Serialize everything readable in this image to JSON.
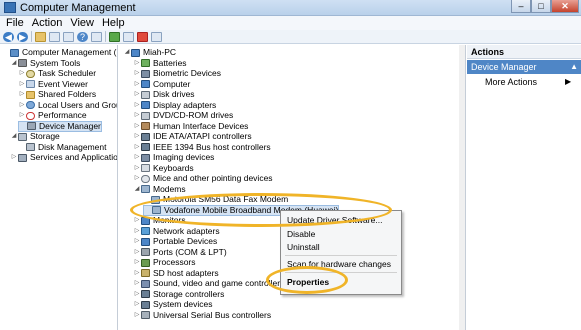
{
  "window": {
    "title": "Computer Management"
  },
  "menu": [
    "File",
    "Action",
    "View",
    "Help"
  ],
  "left_tree": [
    {
      "label": "Computer Management (Local",
      "icon": "computer-management-icon",
      "depth": 0,
      "exp": ""
    },
    {
      "label": "System Tools",
      "icon": "system-tools-icon",
      "depth": 1,
      "exp": "◢"
    },
    {
      "label": "Task Scheduler",
      "icon": "task-scheduler-icon",
      "depth": 2,
      "exp": "▷"
    },
    {
      "label": "Event Viewer",
      "icon": "event-viewer-icon",
      "depth": 2,
      "exp": "▷"
    },
    {
      "label": "Shared Folders",
      "icon": "shared-folders-icon",
      "depth": 2,
      "exp": "▷"
    },
    {
      "label": "Local Users and Groups",
      "icon": "local-users-icon",
      "depth": 2,
      "exp": "▷"
    },
    {
      "label": "Performance",
      "icon": "performance-icon",
      "depth": 2,
      "exp": "▷"
    },
    {
      "label": "Device Manager",
      "icon": "device-manager-icon",
      "depth": 2,
      "exp": "",
      "selected": true
    },
    {
      "label": "Storage",
      "icon": "storage-icon",
      "depth": 1,
      "exp": "◢"
    },
    {
      "label": "Disk Management",
      "icon": "disk-management-icon",
      "depth": 2,
      "exp": ""
    },
    {
      "label": "Services and Applications",
      "icon": "services-icon",
      "depth": 1,
      "exp": "▷"
    }
  ],
  "device_tree": [
    {
      "label": "Miah-PC",
      "icon": "pc-icon",
      "depth": 0,
      "exp": "◢"
    },
    {
      "label": "Batteries",
      "icon": "battery-icon",
      "depth": 1,
      "exp": "▷"
    },
    {
      "label": "Biometric Devices",
      "icon": "biometric-icon",
      "depth": 1,
      "exp": "▷"
    },
    {
      "label": "Computer",
      "icon": "computer-icon",
      "depth": 1,
      "exp": "▷"
    },
    {
      "label": "Disk drives",
      "icon": "disk-drive-icon",
      "depth": 1,
      "exp": "▷"
    },
    {
      "label": "Display adapters",
      "icon": "display-adapter-icon",
      "depth": 1,
      "exp": "▷"
    },
    {
      "label": "DVD/CD-ROM drives",
      "icon": "dvd-drive-icon",
      "depth": 1,
      "exp": "▷"
    },
    {
      "label": "Human Interface Devices",
      "icon": "hid-icon",
      "depth": 1,
      "exp": "▷"
    },
    {
      "label": "IDE ATA/ATAPI controllers",
      "icon": "ide-controller-icon",
      "depth": 1,
      "exp": "▷"
    },
    {
      "label": "IEEE 1394 Bus host controllers",
      "icon": "ieee1394-icon",
      "depth": 1,
      "exp": "▷"
    },
    {
      "label": "Imaging devices",
      "icon": "imaging-icon",
      "depth": 1,
      "exp": "▷"
    },
    {
      "label": "Keyboards",
      "icon": "keyboard-icon",
      "depth": 1,
      "exp": "▷"
    },
    {
      "label": "Mice and other pointing devices",
      "icon": "mouse-icon",
      "depth": 1,
      "exp": "▷"
    },
    {
      "label": "Modems",
      "icon": "modem-icon",
      "depth": 1,
      "exp": "◢"
    },
    {
      "label": "Motorola SM56 Data Fax Modem",
      "icon": "modem-device-icon",
      "depth": 2,
      "exp": ""
    },
    {
      "label": "Vodafone Mobile Broadband Modem (Huawei)",
      "icon": "modem-device-icon",
      "depth": 2,
      "exp": "",
      "selected": true
    },
    {
      "label": "Monitors",
      "icon": "monitor-icon",
      "depth": 1,
      "exp": "▷"
    },
    {
      "label": "Network adapters",
      "icon": "network-adapter-icon",
      "depth": 1,
      "exp": "▷"
    },
    {
      "label": "Portable Devices",
      "icon": "portable-device-icon",
      "depth": 1,
      "exp": "▷"
    },
    {
      "label": "Ports (COM & LPT)",
      "icon": "ports-icon",
      "depth": 1,
      "exp": "▷"
    },
    {
      "label": "Processors",
      "icon": "processor-icon",
      "depth": 1,
      "exp": "▷"
    },
    {
      "label": "SD host adapters",
      "icon": "sd-host-icon",
      "depth": 1,
      "exp": "▷"
    },
    {
      "label": "Sound, video and game controllers",
      "icon": "sound-icon",
      "depth": 1,
      "exp": "▷"
    },
    {
      "label": "Storage controllers",
      "icon": "storage-controller-icon",
      "depth": 1,
      "exp": "▷"
    },
    {
      "label": "System devices",
      "icon": "system-devices-icon",
      "depth": 1,
      "exp": "▷"
    },
    {
      "label": "Universal Serial Bus controllers",
      "icon": "usb-icon",
      "depth": 1,
      "exp": "▷"
    }
  ],
  "actions": {
    "header": "Actions",
    "section": "Device Manager",
    "more": "More Actions"
  },
  "context_menu": {
    "update": "Update Driver Software...",
    "disable": "Disable",
    "uninstall": "Uninstall",
    "scan": "Scan for hardware changes",
    "properties": "Properties"
  },
  "colors": {
    "highlight_oval": "#f0b428",
    "selection": "#d5e3f3",
    "actions_section": "#4f86c6"
  }
}
